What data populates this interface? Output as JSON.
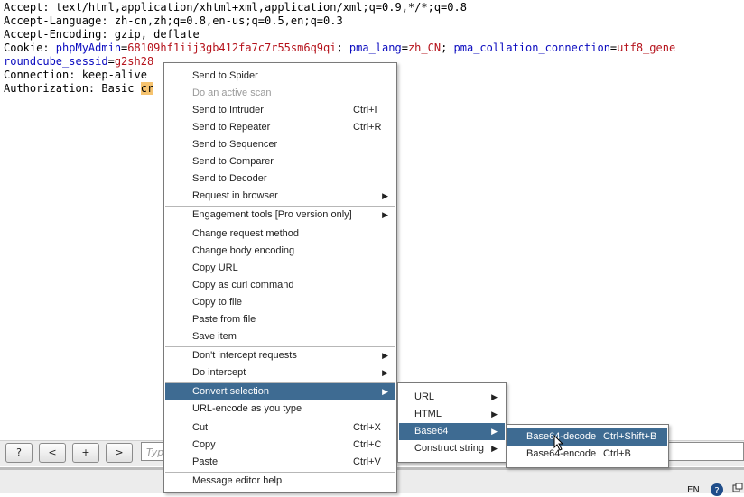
{
  "editor": {
    "lines": [
      {
        "key": "Accept: ",
        "value": "text/html,application/xhtml+xml,application/xml;q=0.9,*/*;q=0.8"
      },
      {
        "key": "Accept-Language: ",
        "value": "zh-cn,zh;q=0.8,en-us;q=0.5,en;q=0.3"
      },
      {
        "key": "Accept-Encoding: ",
        "value": "gzip, deflate"
      },
      {
        "key": "Connection: ",
        "value": "keep-alive"
      },
      {
        "key": "Authorization: ",
        "value": "Basic"
      }
    ],
    "cookie": {
      "label": "Cookie: ",
      "p1_name": "phpMyAdmin",
      "p1_eq": "=",
      "p1_value": "68109hf1iij3gb412fa7c7r55sm6q9qi",
      "sep": "; ",
      "p2_name": "pma_lang",
      "p2_eq": "=",
      "p2_value": "zh_CN",
      "p3_name": "pma_collation_connection",
      "p3_eq": "=",
      "p3_value": "utf8_gene",
      "p4_name": "roundcube_sessid",
      "p4_eq": "=",
      "p4_value": "g2sh28"
    },
    "selection_text": "cr"
  },
  "context_menu": {
    "items": [
      {
        "label": "Send to Spider",
        "shortcut": "",
        "disabled": false
      },
      {
        "label": "Do an active scan",
        "shortcut": "",
        "disabled": true
      },
      {
        "label": "Send to Intruder",
        "shortcut": "Ctrl+I",
        "disabled": false
      },
      {
        "label": "Send to Repeater",
        "shortcut": "Ctrl+R",
        "disabled": false
      },
      {
        "label": "Send to Sequencer",
        "shortcut": "",
        "disabled": false
      },
      {
        "label": "Send to Comparer",
        "shortcut": "",
        "disabled": false
      },
      {
        "label": "Send to Decoder",
        "shortcut": "",
        "disabled": false
      },
      {
        "label": "Request in browser",
        "shortcut": "",
        "disabled": false
      },
      {
        "label": "Engagement tools [Pro version only]",
        "shortcut": "",
        "disabled": false
      },
      {
        "label": "Change request method",
        "shortcut": "",
        "disabled": false
      },
      {
        "label": "Change body encoding",
        "shortcut": "",
        "disabled": false
      },
      {
        "label": "Copy URL",
        "shortcut": "",
        "disabled": false
      },
      {
        "label": "Copy as curl command",
        "shortcut": "",
        "disabled": false
      },
      {
        "label": "Copy to file",
        "shortcut": "",
        "disabled": false
      },
      {
        "label": "Paste from file",
        "shortcut": "",
        "disabled": false
      },
      {
        "label": "Save item",
        "shortcut": "",
        "disabled": false
      },
      {
        "label": "Don't intercept requests",
        "shortcut": "",
        "disabled": false
      },
      {
        "label": "Do intercept",
        "shortcut": "",
        "disabled": false
      },
      {
        "label": "Convert selection",
        "shortcut": "",
        "disabled": false
      },
      {
        "label": "URL-encode as you type",
        "shortcut": "",
        "disabled": false
      },
      {
        "label": "Cut",
        "shortcut": "Ctrl+X",
        "disabled": false
      },
      {
        "label": "Copy",
        "shortcut": "Ctrl+C",
        "disabled": false
      },
      {
        "label": "Paste",
        "shortcut": "Ctrl+V",
        "disabled": false
      },
      {
        "label": "Message editor help",
        "shortcut": "",
        "disabled": false
      }
    ]
  },
  "convert_submenu": {
    "items": [
      {
        "label": "URL"
      },
      {
        "label": "HTML"
      },
      {
        "label": "Base64"
      },
      {
        "label": "Construct string"
      }
    ]
  },
  "base64_submenu": {
    "items": [
      {
        "label": "Base64-decode",
        "shortcut": "Ctrl+Shift+B"
      },
      {
        "label": "Base64-encode",
        "shortcut": "Ctrl+B"
      }
    ]
  },
  "toolbar": {
    "help_label": "?",
    "prev_label": "<",
    "add_label": "+",
    "next_label": ">",
    "search_placeholder": "Type"
  },
  "status": {
    "lang": "EN"
  }
}
